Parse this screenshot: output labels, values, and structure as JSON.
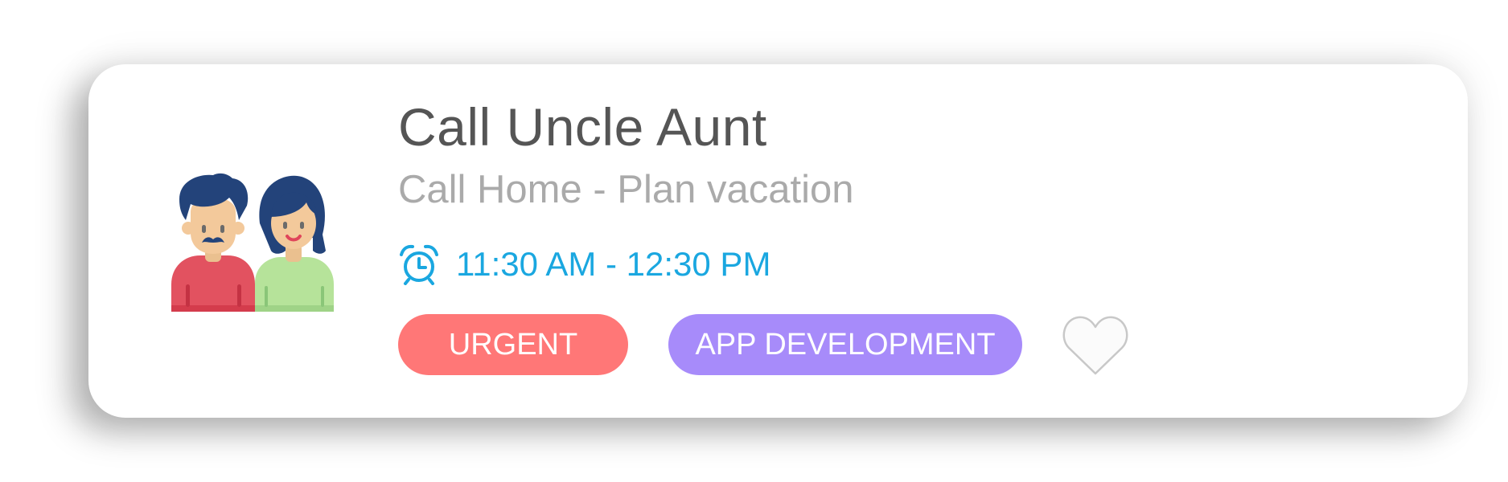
{
  "task": {
    "title": "Call Uncle Aunt",
    "subtitle": "Call Home - Plan vacation",
    "time_range": "11:30 AM - 12:30 PM",
    "avatar_icon": "family-couple-icon",
    "time_icon": "alarm-clock-icon",
    "tags": [
      {
        "label": "URGENT",
        "color": "#ff7777"
      },
      {
        "label": "APP DEVELOPMENT",
        "color": "#a78bfa"
      }
    ],
    "favorite": {
      "icon": "heart-outline-icon",
      "selected": false
    }
  },
  "colors": {
    "title": "#555555",
    "subtitle": "#aaaaaa",
    "time": "#1aa7e0",
    "card_bg": "#ffffff"
  }
}
